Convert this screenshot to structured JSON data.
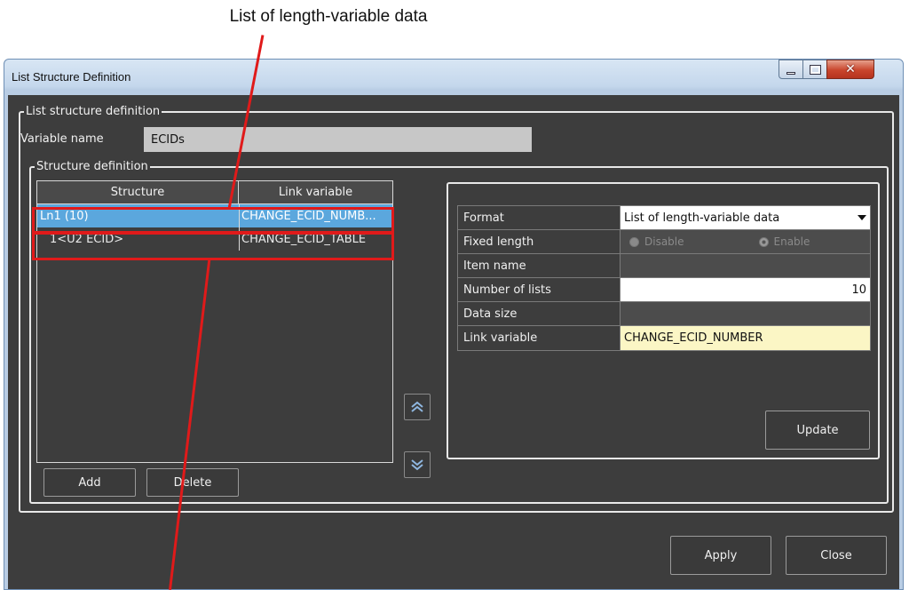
{
  "callout_top": "List of length-variable data",
  "window": {
    "title": "List Structure Definition",
    "close_glyph": "✕"
  },
  "group_outer": {
    "legend": "List structure definition"
  },
  "variable": {
    "label": "Variable name",
    "value": "ECIDs"
  },
  "group_structure": {
    "legend": "Structure definition"
  },
  "table": {
    "headers": [
      "Structure",
      "Link variable"
    ],
    "rows": [
      {
        "structure": "Ln1 (10)",
        "link": "CHANGE_ECID_NUMB...",
        "selected": true
      },
      {
        "structure": "1<U2 ECID>",
        "link": "CHANGE_ECID_TABLE",
        "selected": false
      }
    ]
  },
  "buttons": {
    "add": "Add",
    "delete": "Delete",
    "update": "Update",
    "apply": "Apply",
    "close": "Close"
  },
  "icons": {
    "up": "chevrons-up-icon",
    "down": "chevrons-down-icon"
  },
  "props": {
    "format": {
      "label": "Format",
      "value": "List of length-variable data"
    },
    "fixed_length": {
      "label": "Fixed length",
      "opt1": "Disable",
      "opt2": "Enable"
    },
    "item_name": {
      "label": "Item name",
      "value": ""
    },
    "num_lists": {
      "label": "Number of lists",
      "value": "10"
    },
    "data_size": {
      "label": "Data size",
      "value": ""
    },
    "link_variable": {
      "label": "Link variable",
      "value": "CHANGE_ECID_NUMBER"
    }
  },
  "colors": {
    "highlight": "#e01a1a",
    "selection": "#5ba7dd",
    "dialog_bg": "#3d3d3d"
  }
}
